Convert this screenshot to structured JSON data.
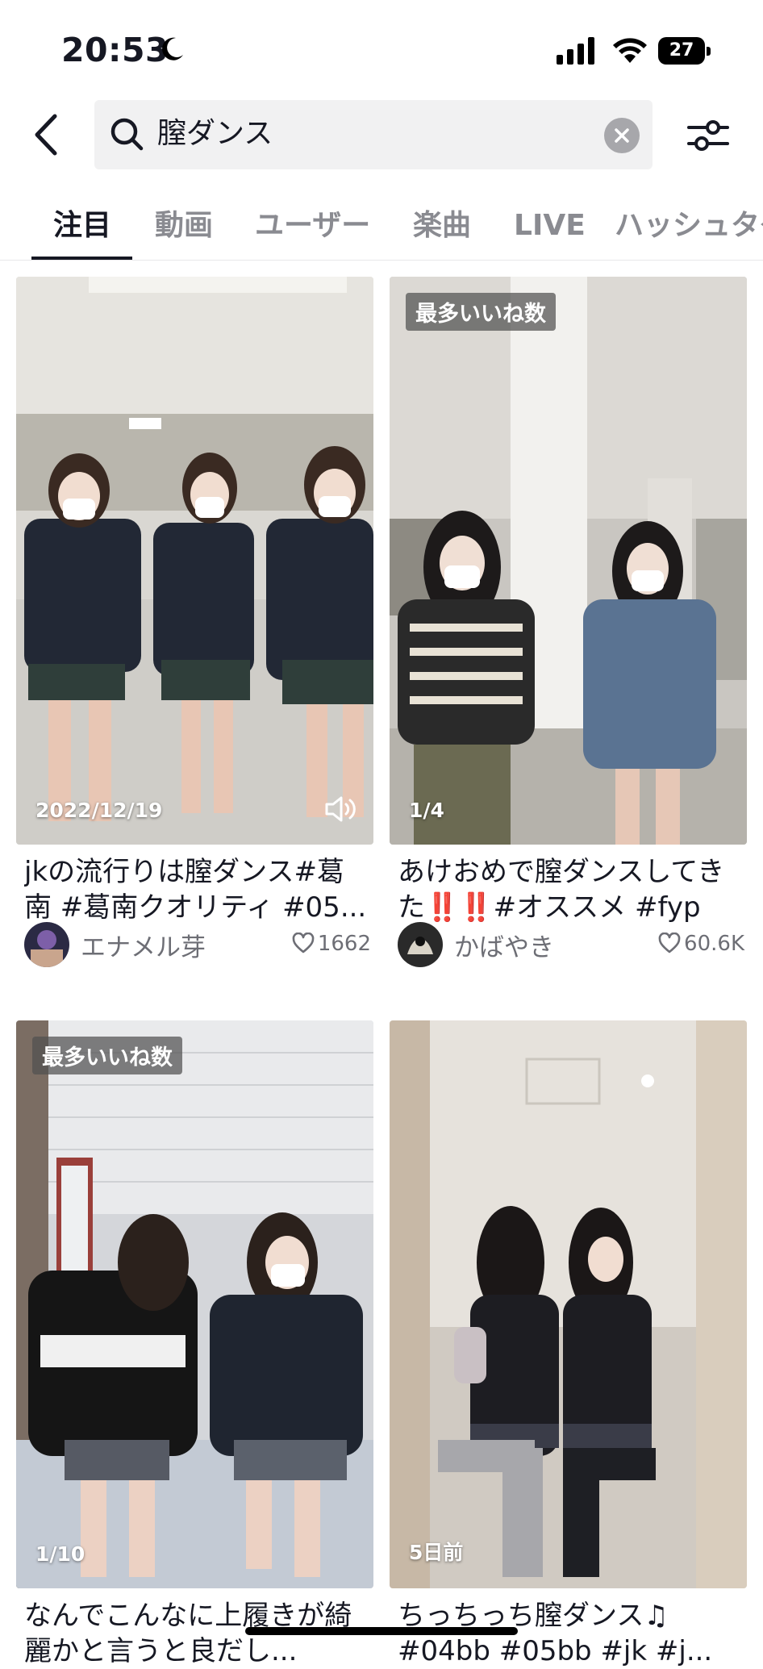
{
  "status_bar": {
    "time": "20:53",
    "battery": "27"
  },
  "search": {
    "query": "膣ダンス"
  },
  "tabs": [
    {
      "label": "注目",
      "active": true
    },
    {
      "label": "動画"
    },
    {
      "label": "ユーザー"
    },
    {
      "label": "楽曲"
    },
    {
      "label": "LIVE"
    },
    {
      "label": "ハッシュタグ"
    }
  ],
  "cards": [
    {
      "badge": "",
      "overlay": "2022/12/19",
      "caption": "jkの流行りは膣ダンス#葛南 #葛南クオリティ #05...",
      "author": "エナメル芽",
      "likes": "1662"
    },
    {
      "badge": "最多いいね数",
      "overlay": "1/4",
      "caption_a": "あけおめで膣ダンスしてきた",
      "caption_emoji": "‼️‼️",
      "caption_b": "#オススメ #fyp",
      "author": "かばやき",
      "likes": "60.6K"
    },
    {
      "badge": "最多いいね数",
      "overlay": "1/10",
      "caption": "なんでこんなに上履きが綺麗かと言うと良だし..."
    },
    {
      "badge": "",
      "overlay": "5日前",
      "caption": "ちっちっち膣ダンス♫ #04bb #05bb #jk #j..."
    }
  ],
  "colors": {
    "text": "#161823",
    "muted": "#8a8b91",
    "accent_red": "#e02b2b"
  }
}
